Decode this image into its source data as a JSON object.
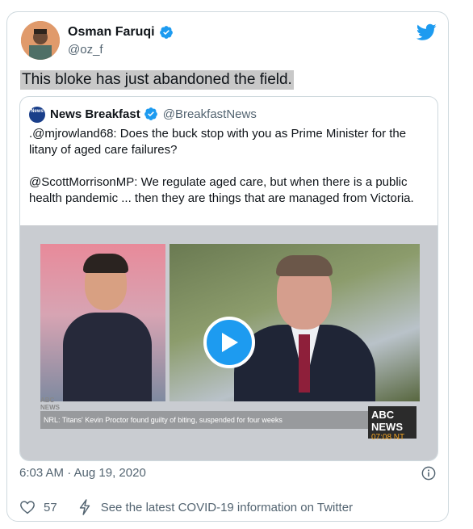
{
  "tweet": {
    "author_name": "Osman Faruqi",
    "author_handle": "@oz_f",
    "text": "This bloke has just abandoned the field.",
    "timestamp": "6:03 AM · Aug 19, 2020",
    "like_count": "57",
    "covid_link": "See the latest COVID-19 information on Twitter"
  },
  "quoted": {
    "avatar_text": "News",
    "author_name": "News Breakfast",
    "author_handle": "@BreakfastNews",
    "paragraph1": ".@mjrowland68: Does the buck stop with you as Prime Minister for the litany of aged care failures?",
    "paragraph2": "@ScottMorrisonMP: We regulate aged care, but when there is a public health pandemic ... then they are things that are managed from Victoria."
  },
  "video": {
    "ticker_logo": "ABC NEWS",
    "ticker_text": "NRL: Titans' Kevin Proctor found guilty of biting, suspended for four weeks",
    "badge_name": "ABC NEWS",
    "badge_time": "07:08 NT"
  },
  "colors": {
    "accent": "#1d9bf0",
    "text": "#0f1419",
    "secondary": "#536471",
    "border": "#cfd9de"
  },
  "icons": [
    "verified-badge-icon",
    "twitter-bird-icon",
    "play-icon",
    "info-icon",
    "heart-icon",
    "lightning-bolt-icon"
  ]
}
